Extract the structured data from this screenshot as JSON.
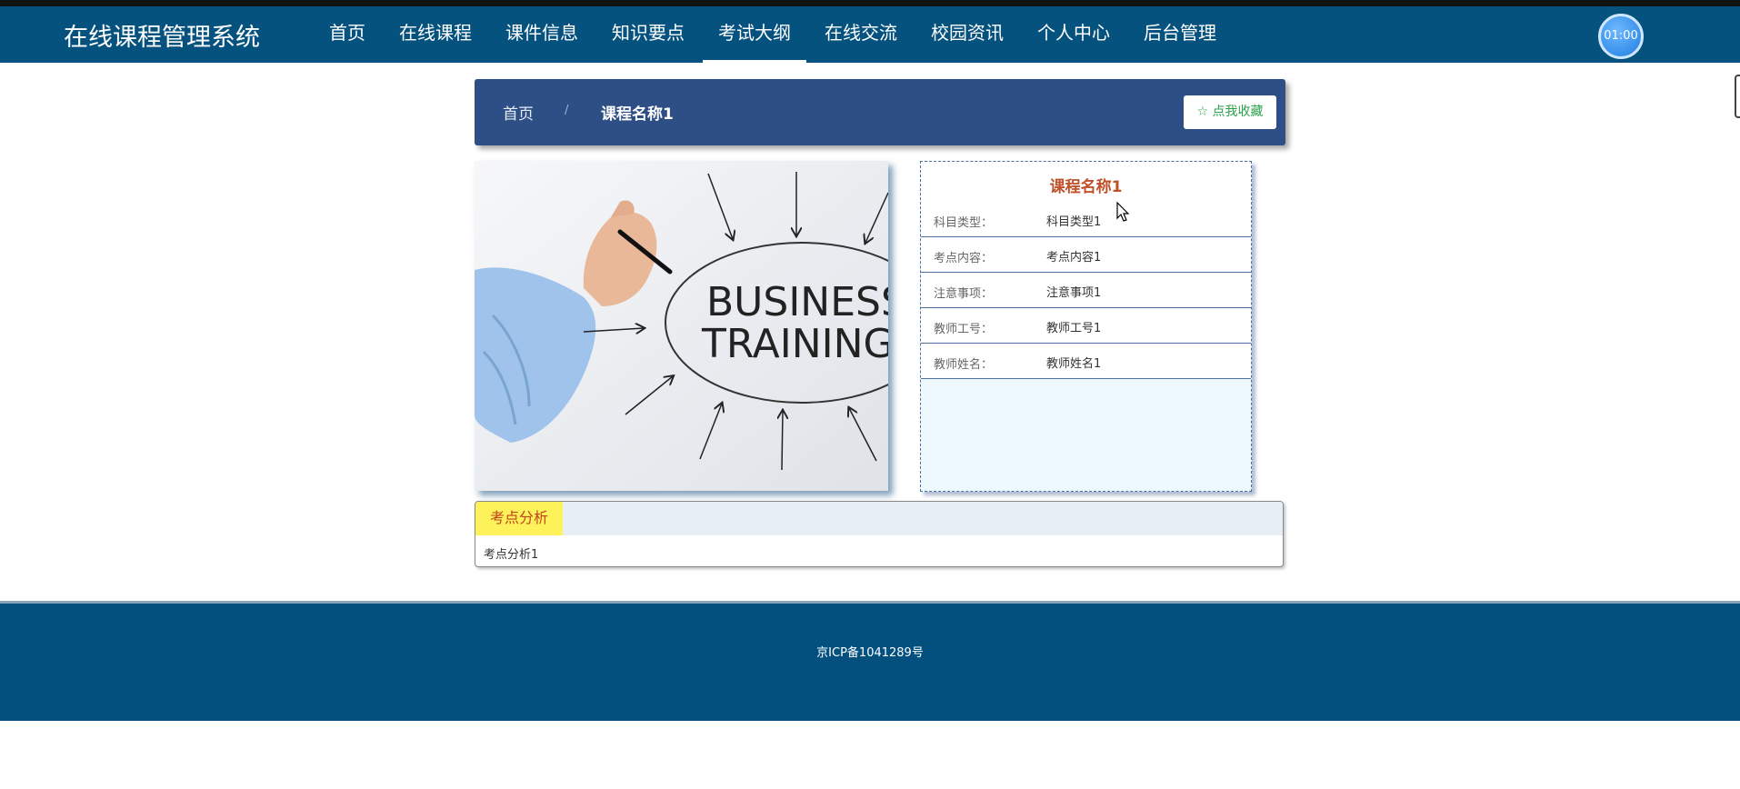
{
  "header": {
    "brand": "在线课程管理系统",
    "nav": [
      {
        "label": "首页"
      },
      {
        "label": "在线课程"
      },
      {
        "label": "课件信息"
      },
      {
        "label": "知识要点"
      },
      {
        "label": "考试大纲",
        "active": true
      },
      {
        "label": "在线交流"
      },
      {
        "label": "校园资讯"
      },
      {
        "label": "个人中心"
      },
      {
        "label": "后台管理"
      }
    ],
    "timer": "01:00"
  },
  "breadcrumb": {
    "home": "首页",
    "separator": "/",
    "current": "课程名称1"
  },
  "favorite_button": "☆ 点我收藏",
  "image": {
    "line1": "BUSINESS",
    "line2": "TRAINING"
  },
  "detail": {
    "title": "课程名称1",
    "fields": [
      {
        "label": "科目类型：",
        "value": "科目类型1"
      },
      {
        "label": "考点内容：",
        "value": "考点内容1"
      },
      {
        "label": "注意事项：",
        "value": "注意事项1"
      },
      {
        "label": "教师工号：",
        "value": "教师工号1"
      },
      {
        "label": "教师姓名：",
        "value": "教师姓名1"
      }
    ]
  },
  "analysis": {
    "tab": "考点分析",
    "content": "考点分析1"
  },
  "footer": {
    "icp": "京ICP备1041289号"
  },
  "colors": {
    "nav_bg": "#06527f",
    "crumb_bg": "#2e4f86",
    "title_accent": "#c0502a",
    "fav_text": "#2aa24a",
    "tab_yellow": "#fdf25a"
  }
}
